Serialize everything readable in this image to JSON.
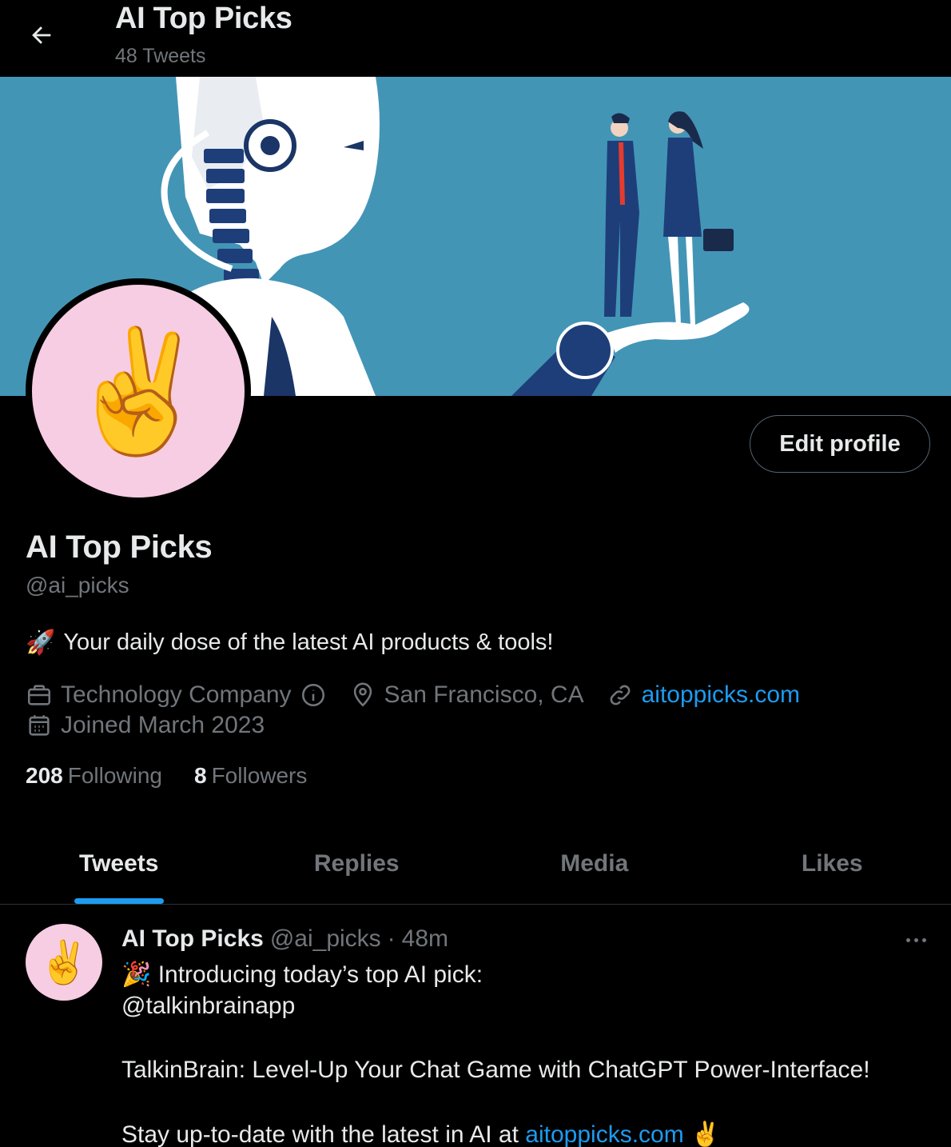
{
  "header": {
    "title": "AI Top Picks",
    "tweet_count": "48 Tweets",
    "back_icon": "arrow-left-icon"
  },
  "profile": {
    "avatar_emoji": "✌️",
    "avatar_bg": "#f6cde2",
    "edit_button": "Edit profile",
    "name": "AI Top Picks",
    "handle": "@ai_picks",
    "bio_emoji": "🚀",
    "bio": "Your daily dose of the latest AI products & tools!",
    "category": "Technology Company",
    "location": "San Francisco, CA",
    "website": "aitoppicks.com",
    "joined": "Joined March 2023",
    "following_count": "208",
    "following_label": "Following",
    "followers_count": "8",
    "followers_label": "Followers"
  },
  "tabs": [
    {
      "label": "Tweets",
      "active": true
    },
    {
      "label": "Replies",
      "active": false
    },
    {
      "label": "Media",
      "active": false
    },
    {
      "label": "Likes",
      "active": false
    }
  ],
  "tweet": {
    "avatar_emoji": "✌️",
    "author_name": "AI Top Picks",
    "author_handle": "@ai_picks",
    "separator": "·",
    "time": "48m",
    "line1_emoji": "🎉",
    "line1": "Introducing today’s top AI pick:",
    "mention": "@talkinbrainapp",
    "line3": "TalkinBrain: Level-Up Your Chat Game with ChatGPT Power-Interface!",
    "line4_text": "Stay up-to-date with the latest in AI at",
    "line4_link": "aitoppicks.com",
    "line4_emoji": "✌️"
  },
  "colors": {
    "background": "#000000",
    "accent": "#1d9bf0",
    "muted": "#71767b",
    "text": "#e7e9ea",
    "banner": "#4395b6"
  }
}
